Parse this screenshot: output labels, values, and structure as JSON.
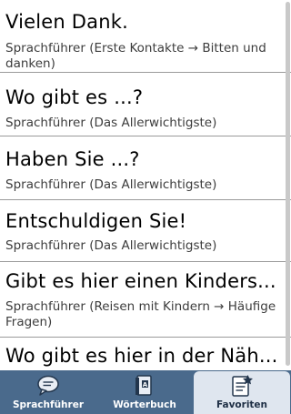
{
  "entries": [
    {
      "title": "Vielen Dank.",
      "subtitle": "Sprachführer (Erste Kontakte → Bitten und danken)"
    },
    {
      "title": "Wo gibt es ...?",
      "subtitle": "Sprachführer (Das Allerwichtigste)"
    },
    {
      "title": "Haben Sie ...?",
      "subtitle": "Sprachführer (Das Allerwichtigste)"
    },
    {
      "title": "Entschuldigen Sie!",
      "subtitle": "Sprachführer (Das Allerwichtigste)"
    },
    {
      "title": "Gibt es hier einen Kinders...",
      "subtitle": "Sprachführer (Reisen mit Kindern → Häufige Fragen)"
    },
    {
      "title": "Wo gibt es hier in der Näh...",
      "subtitle": ""
    }
  ],
  "tabs": [
    {
      "label": "Sprachführer",
      "icon": "speech-bubble-icon",
      "selected": false
    },
    {
      "label": "Wörterbuch",
      "icon": "dictionary-book-icon",
      "selected": false
    },
    {
      "label": "Favoriten",
      "icon": "favorites-document-star-icon",
      "selected": true
    }
  ],
  "colors": {
    "tabbar_bg": "#4a6a8c",
    "tab_selected_bg": "#dfe6ef",
    "divider": "#9a9a9a",
    "subtitle_text": "#3c3c3c"
  }
}
